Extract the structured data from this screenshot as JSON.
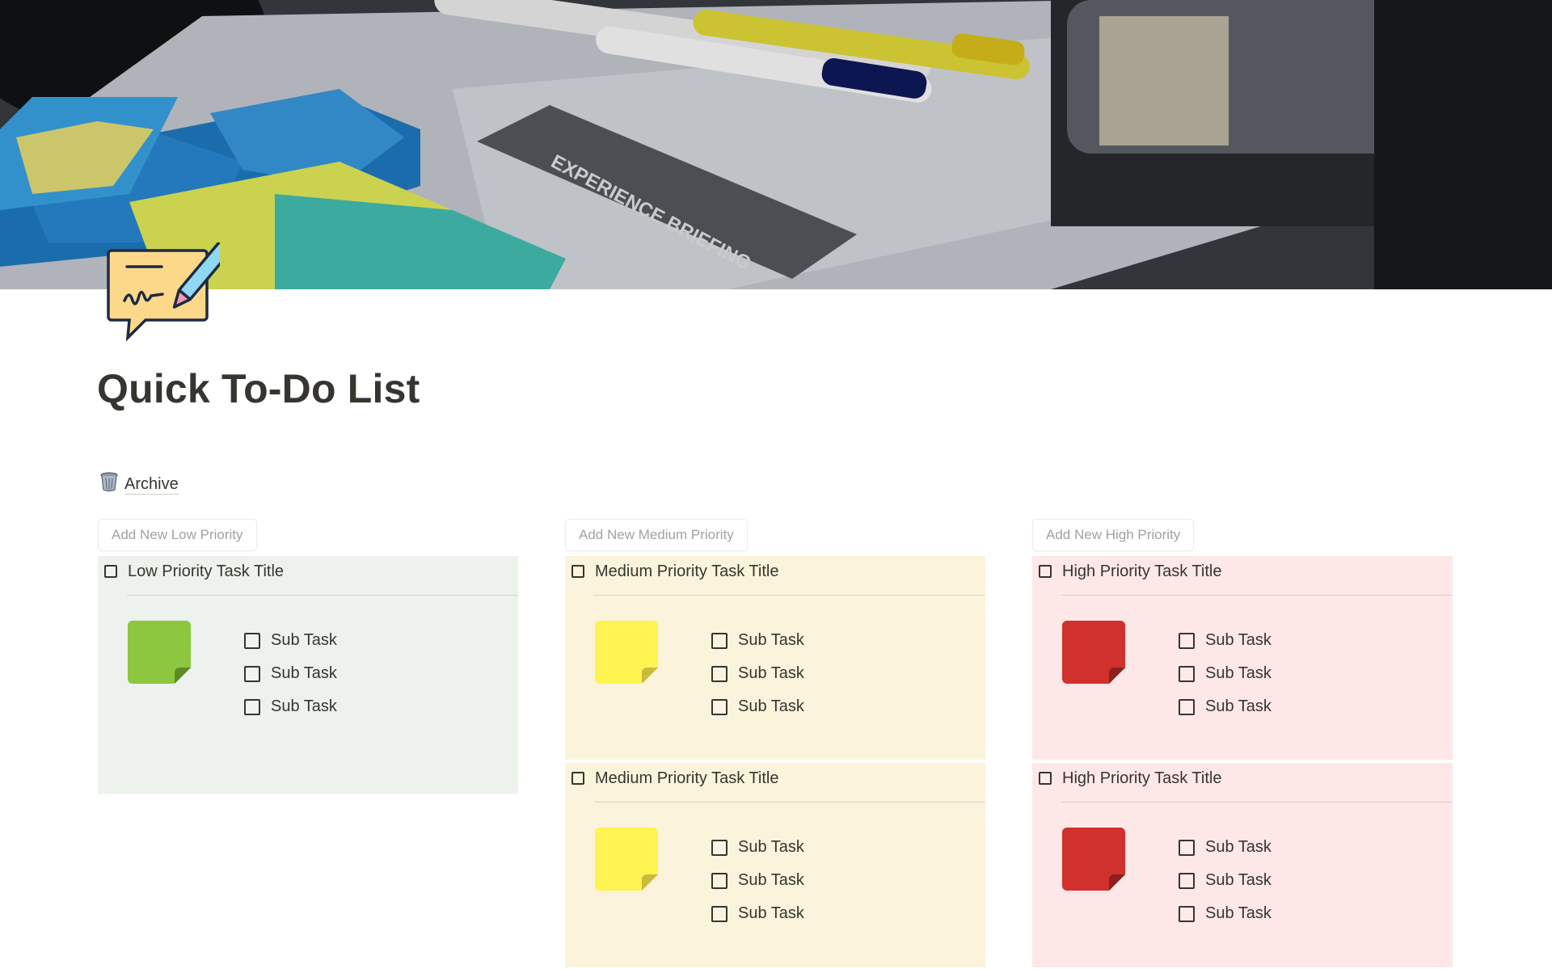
{
  "page": {
    "title": "Quick To-Do List",
    "icon": "writing-speech-bubble-icon",
    "cover": "sticky-notes-and-markers-photo"
  },
  "archive": {
    "icon": "wastebasket-icon",
    "label": "Archive"
  },
  "colors": {
    "low_bg": "#edf2ec",
    "medium_bg": "#fbf3db",
    "high_bg": "#fde8e7",
    "green_note": "#8dc63f",
    "yellow_note": "#fff352",
    "red_note": "#d0312d"
  },
  "columns": [
    {
      "add_label": "Add New Low Priority",
      "cards": [
        {
          "title": "Low Priority Task Title",
          "subtasks": [
            "Sub Task",
            "Sub Task",
            "Sub Task"
          ]
        }
      ]
    },
    {
      "add_label": "Add New Medium Priority",
      "cards": [
        {
          "title": "Medium Priority Task Title",
          "subtasks": [
            "Sub Task",
            "Sub Task",
            "Sub Task"
          ]
        },
        {
          "title": "Medium Priority Task Title",
          "subtasks": [
            "Sub Task",
            "Sub Task",
            "Sub Task"
          ]
        }
      ]
    },
    {
      "add_label": "Add New High Priority",
      "cards": [
        {
          "title": "High Priority Task Title",
          "subtasks": [
            "Sub Task",
            "Sub Task",
            "Sub Task"
          ]
        },
        {
          "title": "High Priority Task Title",
          "subtasks": [
            "Sub Task",
            "Sub Task",
            "Sub Task"
          ]
        }
      ]
    }
  ]
}
